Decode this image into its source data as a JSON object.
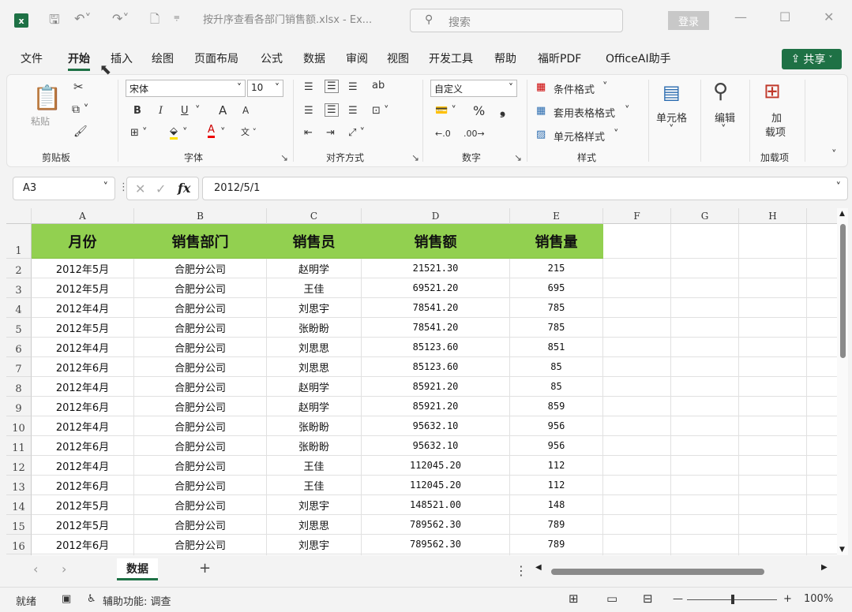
{
  "titlebar": {
    "app_icon": "excel-icon",
    "file_title": "按升序查看各部门销售额.xlsx  -  Ex...",
    "search_placeholder": "搜索",
    "login_label": "登录",
    "minimize": "—",
    "maximize": "☐",
    "close": "✕"
  },
  "menu": {
    "tabs": [
      "文件",
      "开始",
      "插入",
      "绘图",
      "页面布局",
      "公式",
      "数据",
      "审阅",
      "视图",
      "开发工具",
      "帮助",
      "福昕PDF",
      "OfficeAI助手"
    ],
    "active": "开始",
    "share_label": "共享"
  },
  "ribbon": {
    "clipboard": {
      "paste": "粘贴",
      "group": "剪贴板"
    },
    "font": {
      "family": "宋体",
      "size": "10",
      "bold": "B",
      "italic": "I",
      "underline": "U",
      "grow": "A",
      "shrink": "A",
      "group": "字体"
    },
    "alignment": {
      "group": "对齐方式"
    },
    "number": {
      "format": "自定义",
      "percent": "%",
      "comma": "❟",
      "group": "数字"
    },
    "styles": {
      "conditional": "条件格式",
      "table": "套用表格格式",
      "cell": "单元格样式",
      "group": "样式"
    },
    "cells": {
      "label": "单元格"
    },
    "edit": {
      "label": "编辑"
    },
    "addins": {
      "label1": "加",
      "label2": "载项",
      "group": "加载项"
    }
  },
  "formula_bar": {
    "name_box": "A3",
    "fx": "fx",
    "content": "2012/5/1"
  },
  "sheet": {
    "columns": [
      "A",
      "B",
      "C",
      "D",
      "E",
      "F",
      "G",
      "H"
    ],
    "row_numbers": [
      "1",
      "2",
      "3",
      "4",
      "5",
      "6",
      "7",
      "8",
      "9",
      "10",
      "11",
      "12",
      "13",
      "14",
      "15",
      "16"
    ],
    "header": [
      "月份",
      "销售部门",
      "销售员",
      "销售额",
      "销售量"
    ],
    "rows": [
      [
        "2012年5月",
        "合肥分公司",
        "赵明学",
        "21521.30",
        "215"
      ],
      [
        "2012年5月",
        "合肥分公司",
        "王佳",
        "69521.20",
        "695"
      ],
      [
        "2012年4月",
        "合肥分公司",
        "刘思宇",
        "78541.20",
        "785"
      ],
      [
        "2012年5月",
        "合肥分公司",
        "张盼盼",
        "78541.20",
        "785"
      ],
      [
        "2012年4月",
        "合肥分公司",
        "刘思思",
        "85123.60",
        "851"
      ],
      [
        "2012年6月",
        "合肥分公司",
        "刘思思",
        "85123.60",
        "85"
      ],
      [
        "2012年4月",
        "合肥分公司",
        "赵明学",
        "85921.20",
        "85"
      ],
      [
        "2012年6月",
        "合肥分公司",
        "赵明学",
        "85921.20",
        "859"
      ],
      [
        "2012年4月",
        "合肥分公司",
        "张盼盼",
        "95632.10",
        "956"
      ],
      [
        "2012年6月",
        "合肥分公司",
        "张盼盼",
        "95632.10",
        "956"
      ],
      [
        "2012年4月",
        "合肥分公司",
        "王佳",
        "112045.20",
        "112"
      ],
      [
        "2012年6月",
        "合肥分公司",
        "王佳",
        "112045.20",
        "112"
      ],
      [
        "2012年5月",
        "合肥分公司",
        "刘思宇",
        "148521.00",
        "148"
      ],
      [
        "2012年5月",
        "合肥分公司",
        "刘思思",
        "789562.30",
        "789"
      ],
      [
        "2012年6月",
        "合肥分公司",
        "刘思宇",
        "789562.30",
        "789"
      ]
    ]
  },
  "tabs": {
    "sheet_name": "数据",
    "add": "+"
  },
  "status": {
    "ready": "就绪",
    "accessibility": "辅助功能: 调查",
    "zoom": "100%"
  },
  "colors": {
    "accent": "#1e7145",
    "header_fill": "#92d050"
  }
}
